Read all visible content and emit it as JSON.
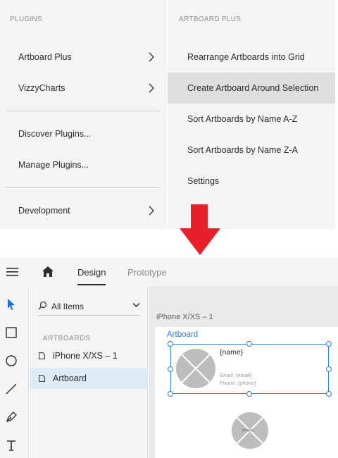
{
  "plugins_menu": {
    "header": "PLUGINS",
    "items": [
      {
        "label": "Artboard Plus"
      },
      {
        "label": "VizzyCharts"
      },
      {
        "label": "Discover Plugins..."
      },
      {
        "label": "Manage Plugins..."
      },
      {
        "label": "Development"
      }
    ]
  },
  "artboard_plus_menu": {
    "header": "ARTBOARD PLUS",
    "items": [
      {
        "label": "Rearrange Artboards into Grid"
      },
      {
        "label": "Create Artboard Around Selection",
        "highlighted": true
      },
      {
        "label": "Sort Artboards by Name A-Z"
      },
      {
        "label": "Sort Artboards by Name Z-A"
      },
      {
        "label": "Settings"
      }
    ]
  },
  "arrow_color": "#e8202a",
  "app": {
    "tabs": {
      "design": "Design",
      "prototype": "Prototype"
    },
    "tools": [
      "select-arrow-icon",
      "rectangle-icon",
      "ellipse-icon",
      "line-icon",
      "pen-icon",
      "text-icon"
    ],
    "layers_panel": {
      "filter": "All Items",
      "section_label": "ARTBOARDS",
      "items": [
        {
          "label": "iPhone X/XS – 1"
        },
        {
          "label": "Artboard",
          "selected": true
        }
      ]
    },
    "canvas": {
      "artboard_title": "iPhone X/XS – 1",
      "artboard_label": "Artboard",
      "card": {
        "name": "{name}",
        "email": "Email: {email}",
        "phone": "Phone: {phone}"
      },
      "image_label": "{image}"
    },
    "accent_color": "#2a7fd3"
  }
}
